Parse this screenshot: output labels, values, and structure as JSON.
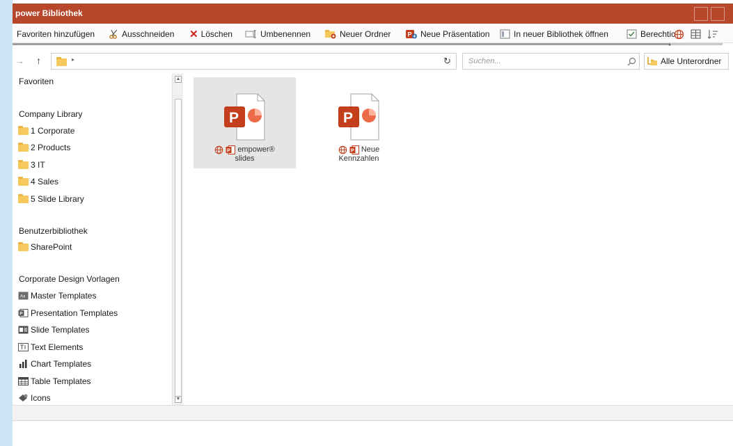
{
  "window": {
    "title": "power Bibliothek"
  },
  "toolbar": {
    "items": [
      {
        "label": "Favoriten hinzufügen",
        "icon": "star-icon"
      },
      {
        "label": "Ausschneiden",
        "icon": "scissors-icon"
      },
      {
        "label": "Löschen",
        "icon": "delete-x-icon"
      },
      {
        "label": "Umbenennen",
        "icon": "rename-icon"
      },
      {
        "label": "Neuer Ordner",
        "icon": "new-folder-icon"
      },
      {
        "label": "Neue Präsentation",
        "icon": "new-presentation-icon"
      },
      {
        "label": "In neuer Bibliothek öffnen",
        "icon": "open-library-icon"
      },
      {
        "label": "Berechtic",
        "icon": "permissions-icon"
      }
    ]
  },
  "address": {
    "search_placeholder": "Suchen...",
    "subfolders_label": "Alle Unterordner"
  },
  "sidebar": {
    "sections": [
      {
        "label": "Favoriten"
      },
      {
        "label": "Company Library",
        "items": [
          "1 Corporate",
          "2 Products",
          "3 IT",
          "4 Sales",
          "5 Slide Library"
        ]
      },
      {
        "label": "Benutzerbibliothek",
        "items": [
          "SharePoint"
        ]
      },
      {
        "label": "Corporate Design Vorlagen",
        "items": [
          "Master Templates",
          "Presentation Templates",
          "Slide Templates",
          "Text Elements",
          "Chart Templates",
          "Table Templates",
          "Icons"
        ]
      }
    ]
  },
  "files": [
    {
      "name_line1": "empower®",
      "name_line2": "slides",
      "selected": true
    },
    {
      "name_line1": "Neue",
      "name_line2": "Kennzahlen",
      "selected": false
    }
  ],
  "colors": {
    "titlebar": "#b7472a",
    "ppt_red": "#c43e1c",
    "folder": "#f6c95e",
    "accent_blue": "#2f6fb3"
  }
}
